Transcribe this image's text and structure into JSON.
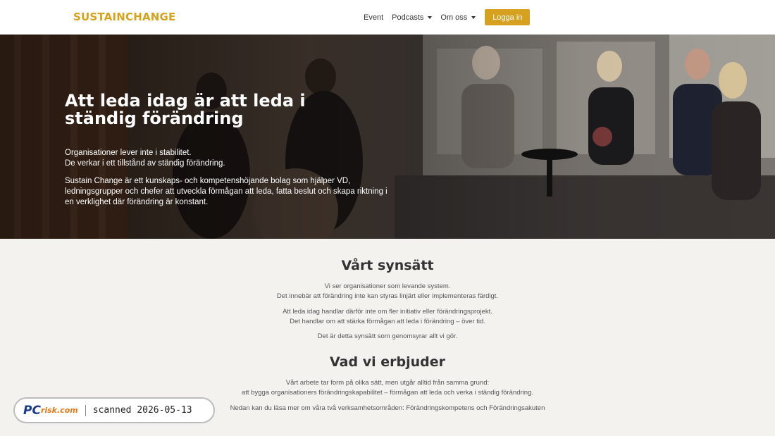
{
  "header": {
    "logo_text": "SUSTAINCHANGE",
    "nav": [
      {
        "label": "Event"
      },
      {
        "label": "Podcasts"
      },
      {
        "label": "Om oss"
      }
    ],
    "login_label": "Logga in"
  },
  "hero": {
    "title": "Att leda idag är att leda i ständig förändring",
    "p1_line1": "Organisationer lever inte i stabilitet.",
    "p1_line2": "De verkar i ett tillstånd av ständig förändring.",
    "p2": "Sustain Change är ett kunskaps- och kompetenshöjande bolag som hjälper VD, ledningsgrupper och chefer att utveckla förmågan att leda, fatta beslut och skapa riktning i en verklighet där förändring är konstant."
  },
  "synsatt": {
    "title": "Vårt synsätt",
    "p1_line1": "Vi ser organisationer som levande system.",
    "p1_line2": "Det innebär att förändring inte kan styras linjärt eller implementeras färdigt.",
    "p2_line1": "Att leda idag handlar därför inte om fler initiativ eller förändringsprojekt.",
    "p2_line2": "Det handlar om att stärka förmågan att leda i förändring – över tid.",
    "p3": "Det är detta synsätt som genomsyrar allt vi gör."
  },
  "erbjuder": {
    "title": "Vad vi erbjuder",
    "p1_line1": "Vårt arbete tar form på olika sätt, men utgår alltid från samma grund:",
    "p1_line2": "att bygga organisationers förändringskapabilitet – förmågan att leda och verka i ständig förändring.",
    "p2": "Nedan kan du läsa mer om våra två verksamhetsområden: Förändringskompetens och Förändringsakuten"
  },
  "watermark": {
    "brand_main": "PC",
    "brand_small": "risk.com",
    "text": "scanned 2026-05-13"
  },
  "colors": {
    "accent": "#d5a11e",
    "header_bg": "#ffffff",
    "page_bg": "#f4f2ee"
  }
}
